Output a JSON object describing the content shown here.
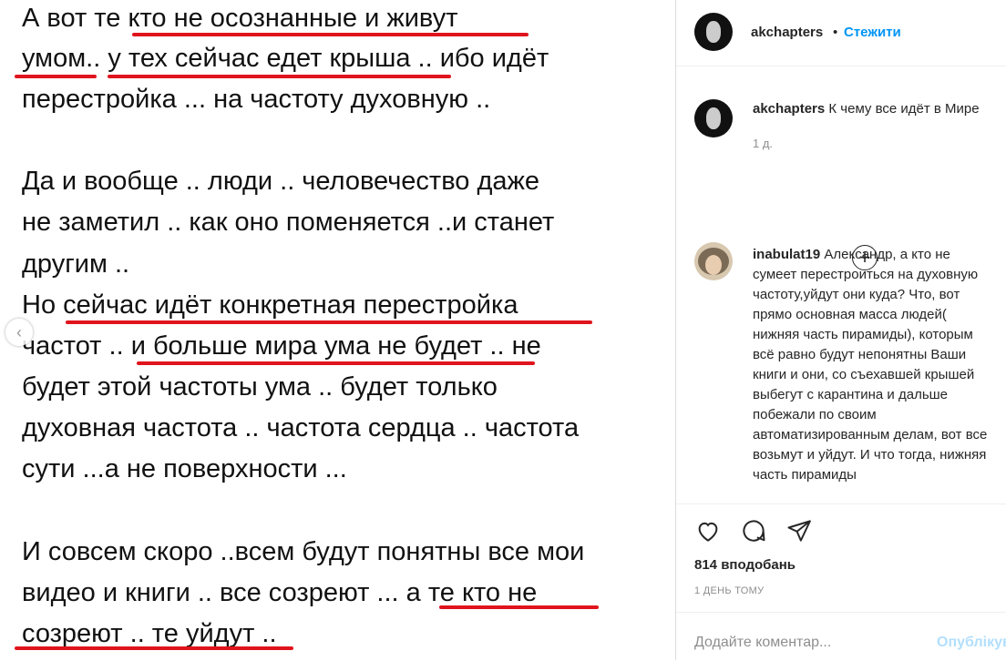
{
  "post": {
    "lines": [
      "А вот те кто не осознанные и живут",
      "умом.. у тех сейчас едет крыша .. ибо идёт",
      "перестройка ... на частоту духовную ..",
      "Да и вообще .. люди .. человечество даже",
      "не заметил .. как оно поменяется ..и станет",
      "другим ..",
      "Но сейчас идёт конкретная перестройка",
      "частот .. и больше мира ума не будет .. не",
      "будет этой частоты ума .. будет только",
      "духовная частота .. частота сердца .. частота",
      "сути ...а не поверхности ...",
      "И совсем скоро ..всем будут понятны все мои",
      "видео и книги .. все созреют ... а те кто не",
      "созреют .. те уйдут .."
    ],
    "underline_color": "#e0141c"
  },
  "header": {
    "username": "akchapters",
    "separator": "•",
    "follow_label": "Стежити"
  },
  "caption": {
    "username": "akchapters",
    "text": "К чему все идёт в Мире",
    "time": "1 д."
  },
  "comment": {
    "username": "inabulat19",
    "text": "Александр, а кто не сумеет перестроиться на духовную частоту,уйдут они куда? Что, вот прямо основная масса людей( нижняя часть пирамиды), которым всё равно будут непонятны Ваши книги и они, со съехавшей крышей выбегут с карантина и дальше побежали по своим автоматизированным делам, вот все возьмут и уйдут. И что тогда, нижняя часть пирамиды"
  },
  "actions": {
    "likes": "814 вподобань",
    "posted": "1 ДЕНЬ ТОМУ"
  },
  "add_comment": {
    "placeholder": "Додайте коментар...",
    "post_label": "Опублікувати"
  },
  "icons": [
    "chevron-left-icon",
    "plus-circle-icon",
    "heart-icon",
    "comment-icon",
    "share-icon"
  ],
  "colors": {
    "link_blue": "#0095f6",
    "post_disabled": "#b2dffc",
    "muted": "#8e8e8e"
  }
}
